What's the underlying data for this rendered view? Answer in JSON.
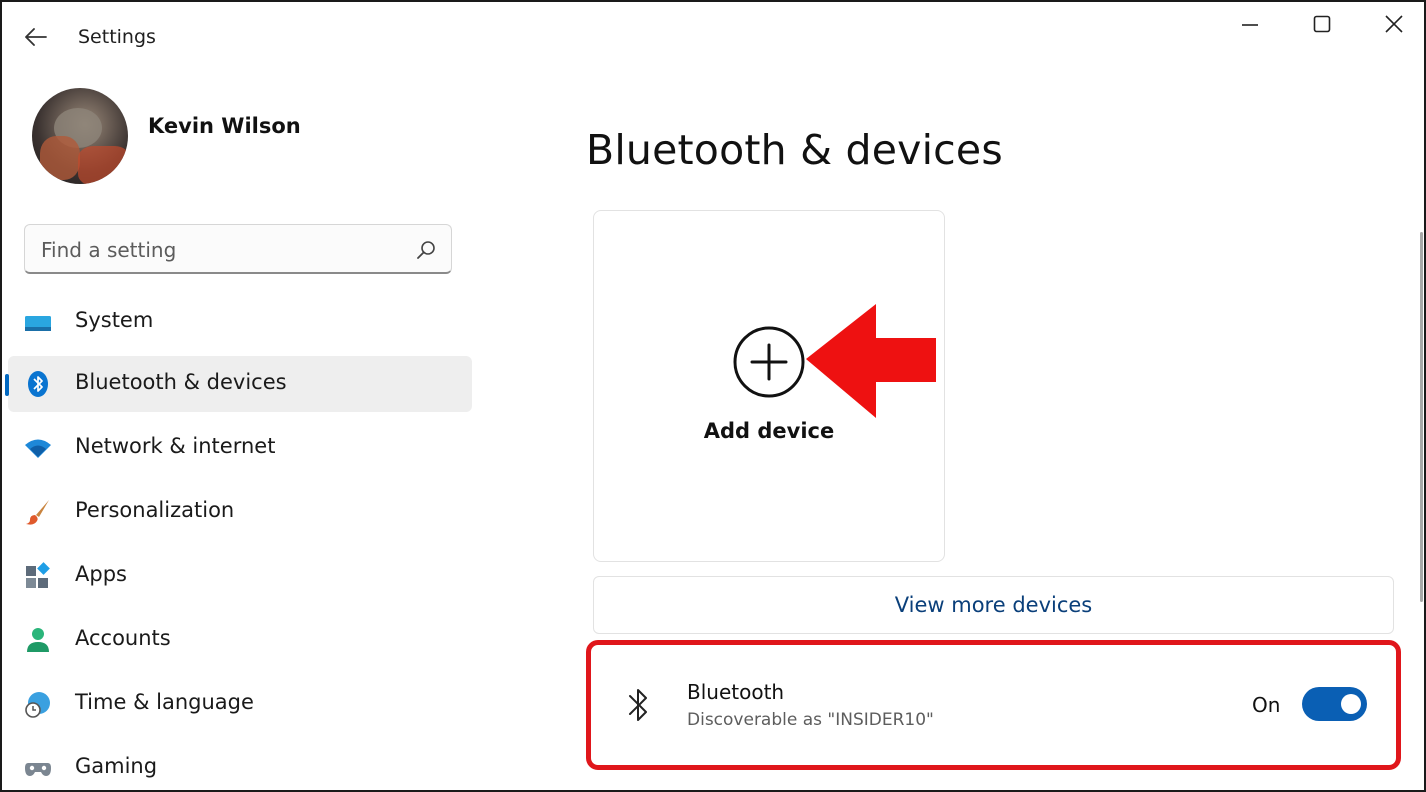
{
  "window": {
    "title": "Settings"
  },
  "profile": {
    "name": "Kevin Wilson"
  },
  "search": {
    "placeholder": "Find a setting"
  },
  "sidebar": {
    "items": [
      {
        "label": "System",
        "icon": "system-icon"
      },
      {
        "label": "Bluetooth & devices",
        "icon": "bluetooth-icon",
        "active": true
      },
      {
        "label": "Network & internet",
        "icon": "wifi-icon"
      },
      {
        "label": "Personalization",
        "icon": "brush-icon"
      },
      {
        "label": "Apps",
        "icon": "apps-icon"
      },
      {
        "label": "Accounts",
        "icon": "person-icon"
      },
      {
        "label": "Time & language",
        "icon": "clock-globe-icon"
      },
      {
        "label": "Gaming",
        "icon": "gamepad-icon"
      }
    ]
  },
  "main": {
    "page_title": "Bluetooth & devices",
    "add_device_label": "Add device",
    "view_more_label": "View more devices",
    "bluetooth": {
      "title": "Bluetooth",
      "subtitle": "Discoverable as \"INSIDER10\"",
      "state_label": "On",
      "enabled": true
    }
  },
  "colors": {
    "accent": "#0a5fb4",
    "highlight": "#e0161b",
    "active_nav_bg": "#eeeeee"
  }
}
